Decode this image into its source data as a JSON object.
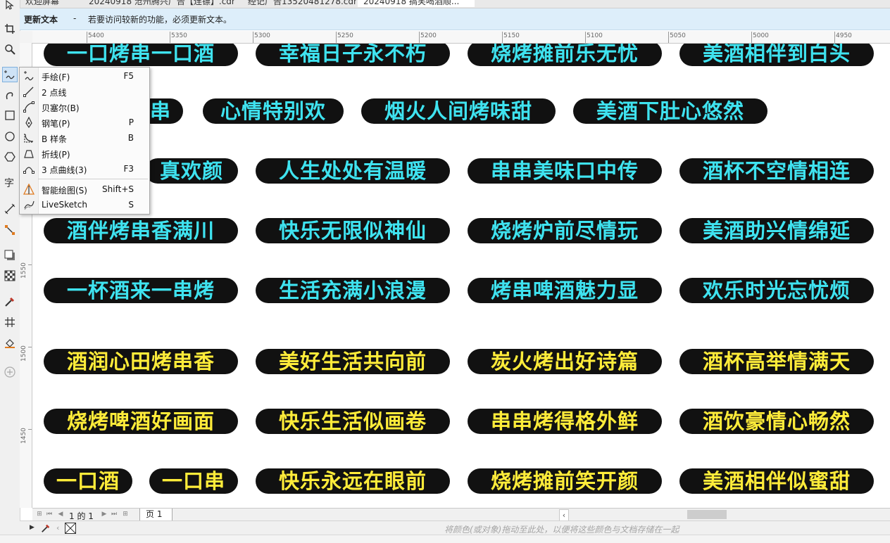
{
  "doc_tabs": [
    "欢迎屏幕",
    "20240918 沧州腾兴广告【连镖】.cdr",
    "经记广告13520481278.cdr",
    "20240918 搞笑喝酒顺..."
  ],
  "info_bar": {
    "title": "更新文本",
    "dash": "-",
    "message": "若要访问较新的功能，必须更新文本。"
  },
  "toolbox": {
    "tools": [
      "pick-tool-icon",
      "crop-tool-icon",
      "zoom-tool-icon",
      "freehand-tool-icon",
      "artistic-media-icon",
      "rectangle-tool-icon",
      "ellipse-tool-icon",
      "polygon-tool-icon",
      "text-tool-icon",
      "parallel-dimension-icon",
      "connector-tool-icon",
      "drop-shadow-icon",
      "transparency-icon",
      "eyedropper-icon",
      "mesh-fill-icon",
      "smart-fill-icon",
      "add-tool-icon"
    ]
  },
  "ruler": {
    "h_labels": [
      "5400",
      "5350",
      "5300",
      "5250",
      "5200",
      "5150",
      "5100",
      "5050",
      "5000",
      "4950"
    ],
    "v_labels": [
      "1550",
      "1500",
      "1450"
    ]
  },
  "flyout": {
    "items": [
      {
        "label": "手绘(F)",
        "key": "F5",
        "icon": "freehand-icon"
      },
      {
        "label": "2 点线",
        "key": "",
        "icon": "two-point-line-icon"
      },
      {
        "label": "贝塞尔(B)",
        "key": "",
        "icon": "bezier-icon"
      },
      {
        "label": "钢笔(P)",
        "key": "P",
        "icon": "pen-icon"
      },
      {
        "label": "B 样条",
        "key": "B",
        "icon": "b-spline-icon"
      },
      {
        "label": "折线(P)",
        "key": "",
        "icon": "polyline-icon"
      },
      {
        "label": "3 点曲线(3)",
        "key": "F3",
        "icon": "three-point-curve-icon"
      },
      {
        "label": "智能绘图(S)",
        "key": "Shift+S",
        "icon": "smart-drawing-icon"
      },
      {
        "label": "LiveSketch",
        "key": "S",
        "icon": "livesketch-icon"
      }
    ]
  },
  "canvas": {
    "rows": [
      {
        "color": "cyan",
        "items": [
          "一口烤串一口酒",
          "幸福日子永不朽",
          "烧烤摊前乐无忧",
          "美酒相伴到白头"
        ]
      },
      {
        "color": "cyan",
        "items": [
          "串",
          "心情特别欢",
          "烟火人间烤味甜",
          "美酒下肚心悠然"
        ]
      },
      {
        "color": "cyan",
        "items": [
          "真欢颜",
          "人生处处有温暖",
          "串串美味口中传",
          "酒杯不空情相连"
        ]
      },
      {
        "color": "cyan",
        "items": [
          "酒伴烤串香满川",
          "快乐无限似神仙",
          "烧烤炉前尽情玩",
          "美酒助兴情绵延"
        ]
      },
      {
        "color": "cyan",
        "items": [
          "一杯酒来一串烤",
          "生活充满小浪漫",
          "烤串啤酒魅力显",
          "欢乐时光忘忧烦"
        ]
      },
      {
        "color": "yellow",
        "items": [
          "酒润心田烤串香",
          "美好生活共向前",
          "炭火烤出好诗篇",
          "酒杯高举情满天"
        ]
      },
      {
        "color": "yellow",
        "items": [
          "烧烤啤酒好画面",
          "快乐生活似画卷",
          "串串烤得格外鲜",
          "酒饮豪情心畅然"
        ]
      },
      {
        "color": "yellow",
        "items": [
          "一口酒",
          "一口串",
          "快乐永远在眼前",
          "烧烤摊前笑开颜",
          "美酒相伴似蜜甜"
        ]
      }
    ]
  },
  "page_nav": {
    "count": "1 的 1",
    "page_tab": "页 1"
  },
  "palette": {
    "hint": "将颜色(或对象)拖动至此处，以便将这些颜色与文档存储在一起"
  }
}
